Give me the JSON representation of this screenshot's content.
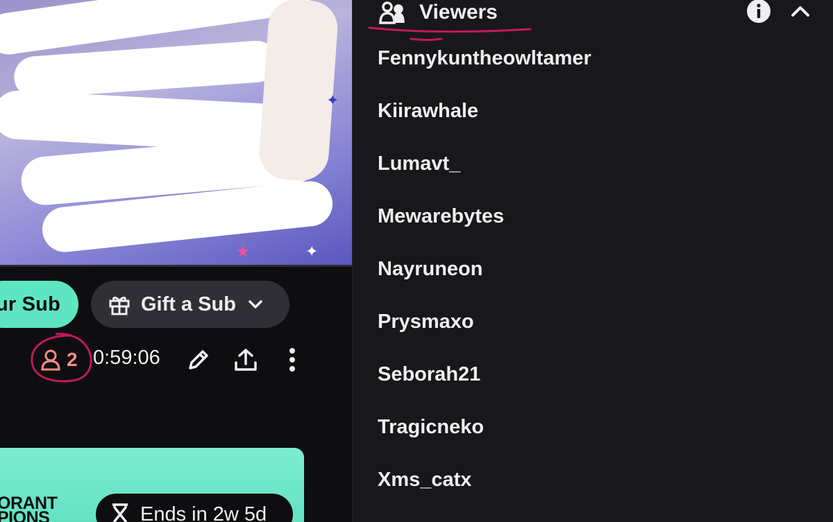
{
  "stream": {
    "sub_button_label": "ur Sub",
    "gift_button_label": "Gift a Sub",
    "viewer_count": "2",
    "uptime": "0:59:06"
  },
  "promo": {
    "text_line1": "ORANT",
    "text_line2": "PIONS",
    "ends_label": "Ends in 2w 5d"
  },
  "viewers": {
    "title": "Viewers",
    "list": [
      "Fennykuntheowltamer",
      "Kiirawhale",
      "Lumavt_",
      "Mewarebytes",
      "Nayruneon",
      "Prysmaxo",
      "Seborah21",
      "Tragicneko",
      "Xms_catx"
    ]
  },
  "colors": {
    "accent_mint": "#5ee6c3",
    "viewer_count": "#ff8a8a",
    "annotation": "#c2185b",
    "panel_bg": "#18181b"
  },
  "icons": {
    "viewers_header": "users-icon",
    "info": "info-icon",
    "collapse": "chevron-up-icon",
    "gift": "gift-icon",
    "viewer_count": "user-icon",
    "edit": "pencil-icon",
    "share": "share-icon",
    "more": "more-vertical-icon",
    "timer": "hourglass-icon"
  }
}
